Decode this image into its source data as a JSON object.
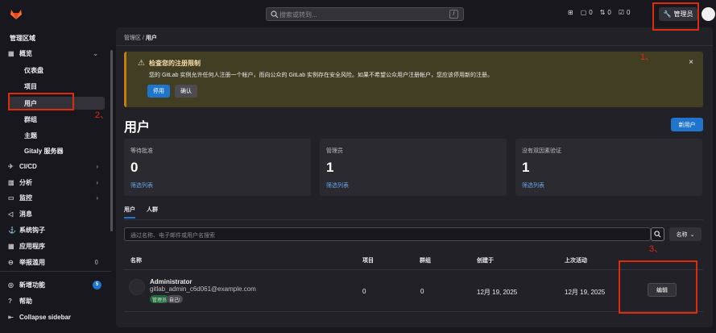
{
  "header": {
    "search_placeholder": "搜索或转到...",
    "search_kbd": "/",
    "mr_count": "0",
    "review_count": "0",
    "todo_count": "0",
    "admin_label": "管理员"
  },
  "annotations": {
    "a1": "1、",
    "a2": "2、",
    "a3": "3、"
  },
  "sidebar": {
    "title": "管理区域",
    "overview": "概览",
    "sub": [
      "仪表盘",
      "项目",
      "用户",
      "群组",
      "主题",
      "Gitaly 服务器"
    ],
    "items": [
      "CI/CD",
      "分析",
      "监控",
      "消息",
      "系统钩子",
      "应用程序",
      "举报滥用"
    ],
    "abuse_count": "0",
    "whats_new": "新增功能",
    "whats_new_count": "5",
    "help": "帮助",
    "collapse": "Collapse sidebar"
  },
  "breadcrumb": {
    "parent": "管理区",
    "sep": "/",
    "current": "用户"
  },
  "alert": {
    "title": "检查您的注册限制",
    "body": "您的 GitLab 实例允许任何人注册一个帐户，而向公众的 GitLab 实例存在安全风险。如果不希望公众用户注册帐户，您应该停用新的注册。",
    "deactivate": "停用",
    "confirm": "确认"
  },
  "page": {
    "title": "用户",
    "new_user": "新用户"
  },
  "stats": [
    {
      "label": "等待批准",
      "value": "0",
      "link": "筛选列表"
    },
    {
      "label": "管理员",
      "value": "1",
      "link": "筛选列表"
    },
    {
      "label": "没有双因素验证",
      "value": "1",
      "link": "筛选列表"
    }
  ],
  "tabs": [
    "用户",
    "人群"
  ],
  "filter": {
    "placeholder": "通过名称、电子邮件或用户名搜索",
    "sort": "名称"
  },
  "table": {
    "headers": [
      "名称",
      "项目",
      "群组",
      "创建于",
      "上次活动"
    ],
    "rows": [
      {
        "name": "Administrator",
        "email": "gitlab_admin_c6d061@example.com",
        "badge_admin": "管理员",
        "badge_self": "自己!",
        "projects": "0",
        "groups": "0",
        "created": "12月 19, 2025",
        "last_activity": "12月 19, 2025",
        "edit": "编辑"
      }
    ]
  },
  "colors": {
    "accent": "#1f75cb",
    "annotation": "#dd2b0e",
    "warning_bg": "#413e23"
  }
}
